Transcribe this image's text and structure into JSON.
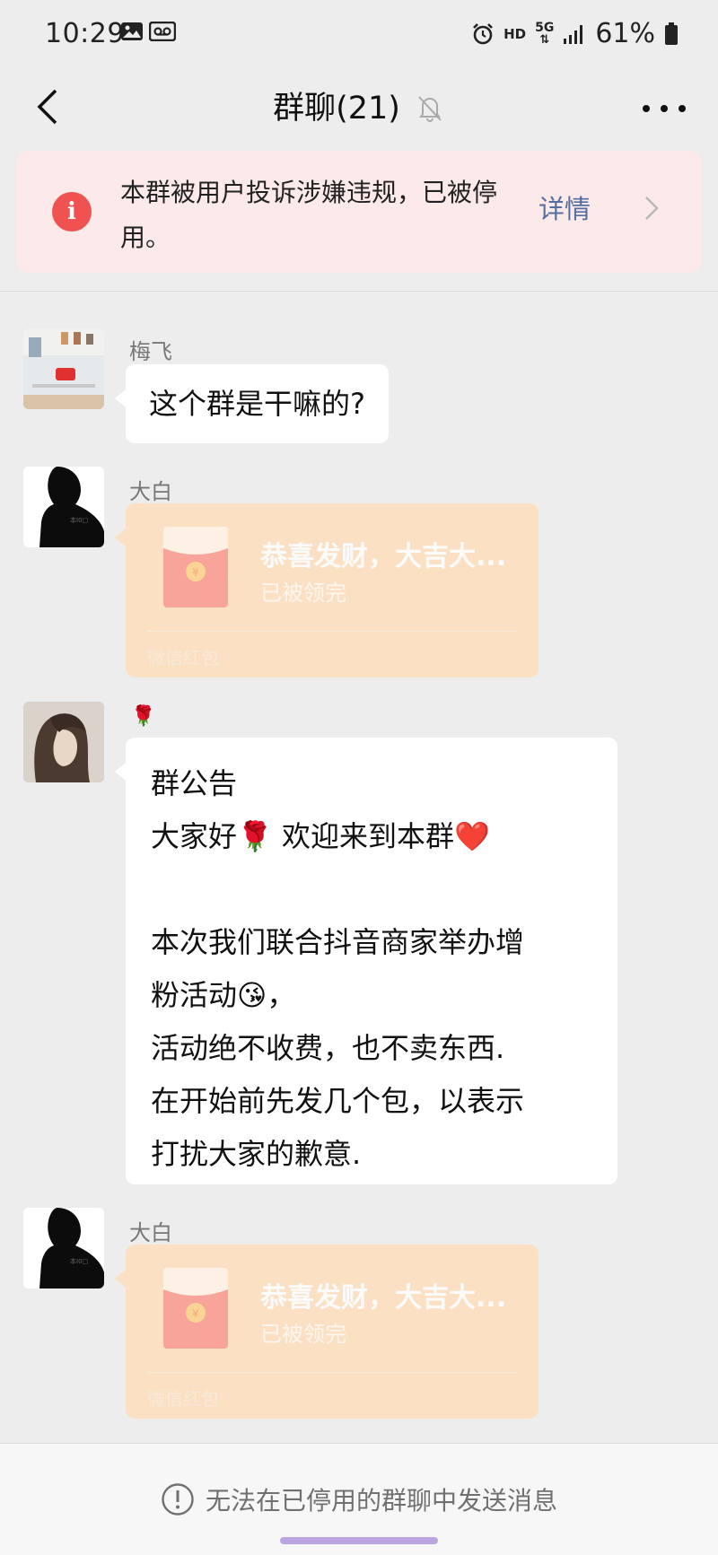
{
  "status_bar": {
    "time": "10:29",
    "network": "HD",
    "signal": "5G",
    "battery": "61%"
  },
  "nav": {
    "title": "群聊(21)",
    "back_icon": "chevron-left-icon",
    "mute_icon": "bell-off-icon",
    "more_icon": "more-dots-icon"
  },
  "banner": {
    "text": "本群被用户投诉涉嫌违规，已被停用。",
    "detail_label": "详情"
  },
  "messages": [
    {
      "type": "text",
      "sender": "梅飞",
      "text": "这个群是干嘛的?"
    },
    {
      "type": "red_packet",
      "sender": "大白",
      "title": "恭喜发财，大吉大...",
      "status": "已被领完",
      "footer": "微信红包"
    },
    {
      "type": "announcement",
      "sender": "🌹",
      "lines": [
        "群公告",
        "大家好🌹  欢迎来到本群❤️",
        "",
        "本次我们联合抖音商家举办增",
        "粉活动😘，",
        "活动绝不收费，也不卖东西.",
        "在开始前先发几个包，以表示",
        "打扰大家的歉意."
      ]
    },
    {
      "type": "red_packet",
      "sender": "大白",
      "title": "恭喜发财，大吉大...",
      "status": "已被领完",
      "footer": "微信红包"
    }
  ],
  "footer": {
    "text": "无法在已停用的群聊中发送消息"
  },
  "colors": {
    "background": "#ededed",
    "banner_bg": "#fce9e9",
    "warning_red": "#f05252",
    "link_blue": "#546ea0",
    "red_packet_bg": "#fce0c4"
  }
}
